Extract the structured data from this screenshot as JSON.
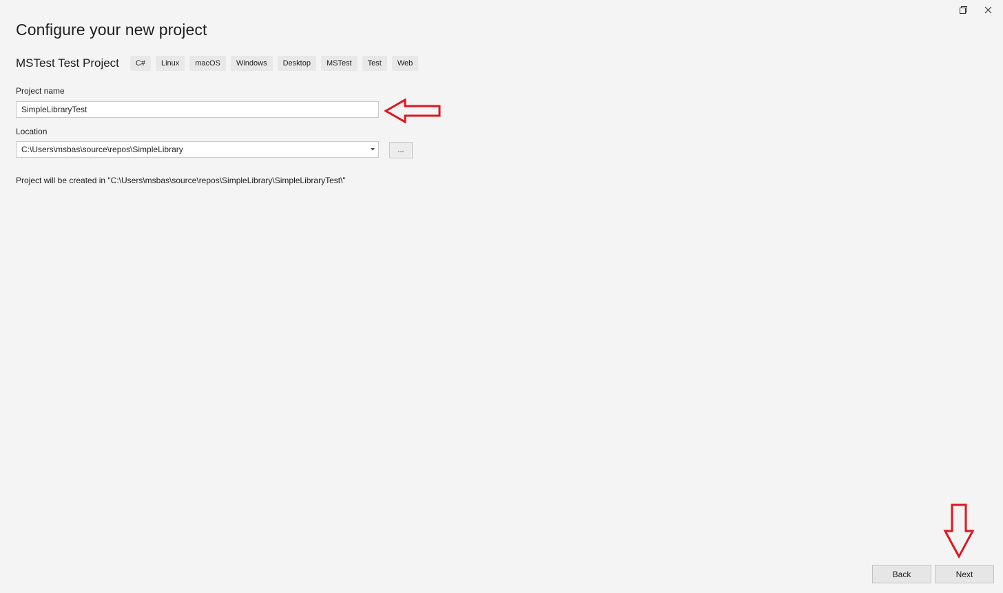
{
  "window": {
    "restore_icon": "restore-icon",
    "close_icon": "close-icon"
  },
  "header": {
    "title": "Configure your new project"
  },
  "template": {
    "name": "MSTest Test Project",
    "tags": [
      "C#",
      "Linux",
      "macOS",
      "Windows",
      "Desktop",
      "MSTest",
      "Test",
      "Web"
    ]
  },
  "form": {
    "project_name_label": "Project name",
    "project_name_value": "SimpleLibraryTest",
    "location_label": "Location",
    "location_value": "C:\\Users\\msbas\\source\\repos\\SimpleLibrary",
    "browse_label": "...",
    "created_path_text": "Project will be created in \"C:\\Users\\msbas\\source\\repos\\SimpleLibrary\\SimpleLibraryTest\\\""
  },
  "footer": {
    "back_label": "Back",
    "next_label": "Next"
  },
  "annotations": {
    "arrow_color": "#e3141b"
  }
}
